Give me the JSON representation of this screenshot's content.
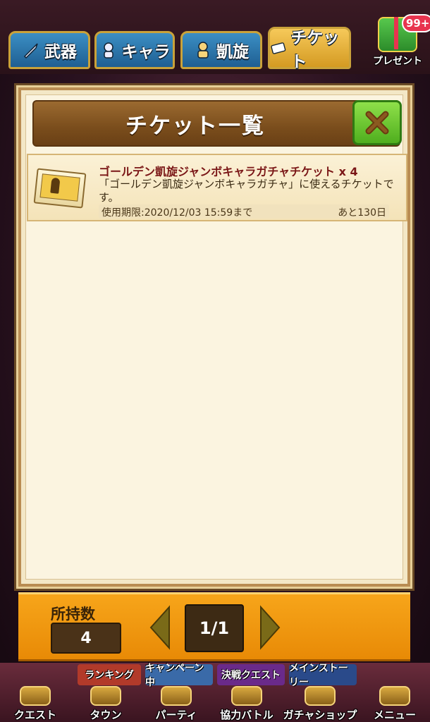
{
  "tabs": [
    {
      "label": "武器",
      "icon": "sword-icon"
    },
    {
      "label": "キャラ",
      "icon": "character-icon"
    },
    {
      "label": "凱旋",
      "icon": "triumph-icon"
    },
    {
      "label": "チケット",
      "icon": "ticket-icon"
    }
  ],
  "active_tab": "チケット",
  "present": {
    "label": "プレゼント",
    "badge": "99+"
  },
  "dialog": {
    "title": "チケット一覧",
    "tickets": [
      {
        "name": "ゴールデン凱旋ジャンボキャラガチャチケット x 4",
        "description": "「ゴールデン凱旋ジャンボキャラガチャ」に使えるチケットです。",
        "expiry": "使用期限:2020/12/03 15:59まで",
        "remaining": "あと130日",
        "icon": "golden-ticket-icon"
      }
    ]
  },
  "footer": {
    "owned_label": "所持数",
    "owned_value": "4",
    "page": "1/1"
  },
  "banners": [
    "ランキング",
    "キャンペーン中",
    "決戦クエスト",
    "メインストーリー"
  ],
  "bottom_nav": [
    {
      "label": "クエスト",
      "icon": "quest-icon"
    },
    {
      "label": "タウン",
      "icon": "town-icon"
    },
    {
      "label": "パーティ",
      "icon": "party-icon"
    },
    {
      "label": "協力バトル",
      "icon": "coop-battle-icon"
    },
    {
      "label": "ガチャショップ",
      "icon": "gacha-shop-icon"
    },
    {
      "label": "メニュー",
      "icon": "menu-icon"
    }
  ],
  "colors": {
    "accent_orange": "#f7a51a",
    "title_brown": "#7a4d1c",
    "close_green": "#4fae1e",
    "ticket_name_red": "#7a1616"
  }
}
